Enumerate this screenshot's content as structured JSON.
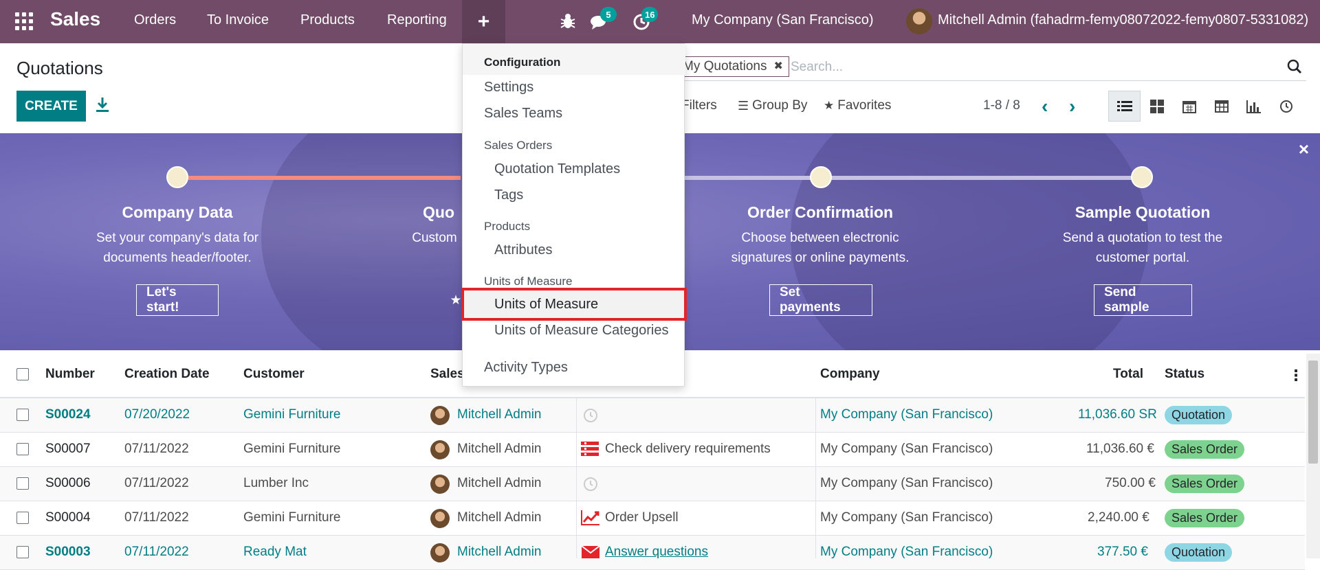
{
  "navbar": {
    "app_name": "Sales",
    "menu": [
      "Orders",
      "To Invoice",
      "Products",
      "Reporting"
    ],
    "plus": "+",
    "messages_count": "5",
    "activities_count": "16",
    "company": "My Company (San Francisco)",
    "user": "Mitchell Admin (fahadrm-femy08072022-femy0807-5331082)"
  },
  "control_panel": {
    "title": "Quotations",
    "create_label": "CREATE",
    "facet": "My Quotations",
    "search_placeholder": "Search...",
    "filters_label": "Filters",
    "groupby_label": "Group By",
    "favorites_label": "Favorites",
    "pager": "1-8 / 8",
    "views": [
      "list-icon",
      "kanban-icon",
      "calendar-icon",
      "pivot-icon",
      "graph-icon",
      "activity-icon"
    ]
  },
  "banner": {
    "close": "×",
    "steps": [
      {
        "title": "Company Data",
        "desc1": "Set your company's data for",
        "desc2": "documents header/footer.",
        "button": "Let's start!"
      },
      {
        "title": "Quo",
        "desc1": "Custom",
        "desc2": "",
        "button": "★"
      },
      {
        "title": "Order Confirmation",
        "desc1": "Choose between electronic",
        "desc2": "signatures or online payments.",
        "button": "Set payments"
      },
      {
        "title": "Sample Quotation",
        "desc1": "Send a quotation to test the",
        "desc2": "customer portal.",
        "button": "Send sample"
      }
    ]
  },
  "dropdown": {
    "sections": [
      {
        "header": "Configuration",
        "items": [
          "Settings",
          "Sales Teams"
        ]
      },
      {
        "header": "Sales Orders",
        "items": [
          "Quotation Templates",
          "Tags"
        ]
      },
      {
        "header": "Products",
        "items": [
          "Attributes"
        ]
      },
      {
        "header": "Units of Measure",
        "items": [
          "Units of Measure",
          "Units of Measure Categories"
        ]
      },
      {
        "header": "",
        "items": [
          "Activity Types"
        ]
      }
    ]
  },
  "table": {
    "headers": [
      "Number",
      "Creation Date",
      "Customer",
      "Sales",
      "Company",
      "Total",
      "Status"
    ],
    "rows": [
      {
        "number": "S00024",
        "date": "07/20/2022",
        "customer": "Gemini Furniture",
        "salesperson": "Mitchell Admin",
        "activity": "",
        "activity_icon": "clock-icon",
        "company": "My Company (San Francisco)",
        "total": "11,036.60 SR",
        "status": "Quotation"
      },
      {
        "number": "S00007",
        "date": "07/11/2022",
        "customer": "Gemini Furniture",
        "salesperson": "Mitchell Admin",
        "activity": "Check delivery requirements",
        "activity_icon": "list-icon",
        "company": "My Company (San Francisco)",
        "total": "11,036.60 €",
        "status": "Sales Order"
      },
      {
        "number": "S00006",
        "date": "07/11/2022",
        "customer": "Lumber Inc",
        "salesperson": "Mitchell Admin",
        "activity": "",
        "activity_icon": "clock-icon",
        "company": "My Company (San Francisco)",
        "total": "750.00 €",
        "status": "Sales Order"
      },
      {
        "number": "S00004",
        "date": "07/11/2022",
        "customer": "Gemini Furniture",
        "salesperson": "Mitchell Admin",
        "activity": "Order Upsell",
        "activity_icon": "chart-icon",
        "company": "My Company (San Francisco)",
        "total": "2,240.00 €",
        "status": "Sales Order"
      },
      {
        "number": "S00003",
        "date": "07/11/2022",
        "customer": "Ready Mat",
        "salesperson": "Mitchell Admin",
        "activity": "Answer questions",
        "activity_icon": "mail-icon",
        "company": "My Company (San Francisco)",
        "total": "377.50 €",
        "status": "Quotation"
      }
    ]
  },
  "colors": {
    "navbar": "#714b67",
    "primary": "#017e84",
    "banner": "#6e68b6",
    "highlight": "#e2242b",
    "quotation_badge": "#8fd6e4",
    "order_badge": "#7dd38e"
  }
}
